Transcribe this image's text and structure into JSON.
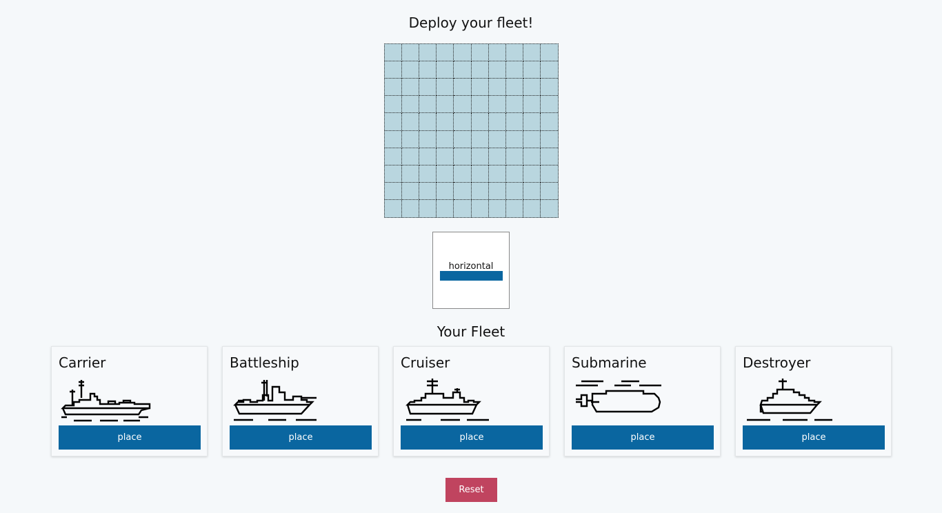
{
  "header": {
    "title": "Deploy your fleet!"
  },
  "board": {
    "rows": 10,
    "cols": 10,
    "color": "#b9d6df"
  },
  "orientation": {
    "label": "horizontal",
    "indicator_color": "#0a66a0"
  },
  "fleet": {
    "title": "Your Fleet",
    "ships": [
      {
        "name": "Carrier",
        "icon": "carrier-icon",
        "button_label": "place"
      },
      {
        "name": "Battleship",
        "icon": "battleship-icon",
        "button_label": "place"
      },
      {
        "name": "Cruiser",
        "icon": "cruiser-icon",
        "button_label": "place"
      },
      {
        "name": "Submarine",
        "icon": "submarine-icon",
        "button_label": "place"
      },
      {
        "name": "Destroyer",
        "icon": "destroyer-icon",
        "button_label": "place"
      }
    ]
  },
  "actions": {
    "reset_label": "Reset"
  },
  "colors": {
    "primary": "#0a66a0",
    "danger": "#c0445f",
    "background": "#f5f8fa"
  }
}
